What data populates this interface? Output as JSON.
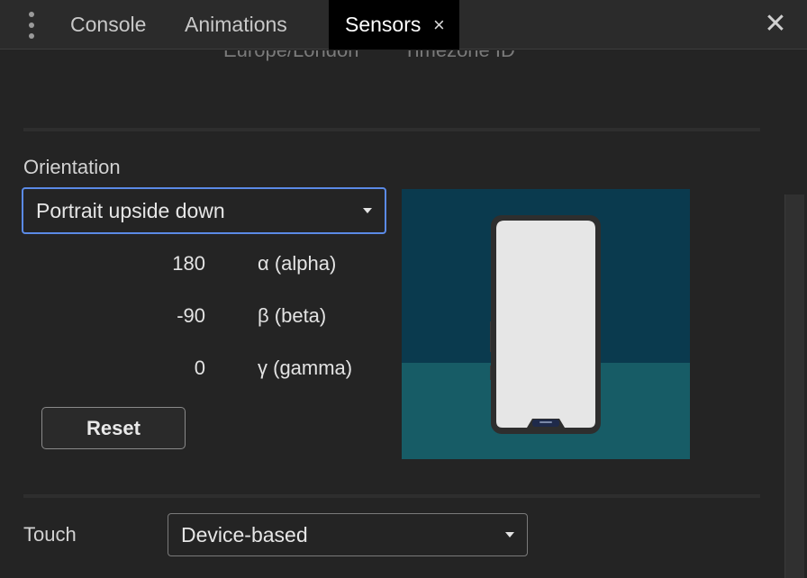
{
  "tabs": [
    {
      "label": "Console"
    },
    {
      "label": "Animations"
    },
    {
      "label": "Sensors",
      "active": true
    }
  ],
  "icons": {
    "menu": "more-vertical-icon",
    "tab_close": "×",
    "panel_close": "✕"
  },
  "timezone": {
    "value": "Europe/London",
    "label": "Timezone ID"
  },
  "orientation": {
    "title": "Orientation",
    "selected": "Portrait upside down",
    "alpha": {
      "value": "180",
      "label": "α (alpha)"
    },
    "beta": {
      "value": "-90",
      "label": "β (beta)"
    },
    "gamma": {
      "value": "0",
      "label": "γ (gamma)"
    },
    "reset_label": "Reset"
  },
  "touch": {
    "label": "Touch",
    "selected": "Device-based"
  },
  "colors": {
    "panel_bg": "#242424",
    "tabbar_bg": "#2b2b2b",
    "active_tab_bg": "#000000",
    "focus_ring": "#5b8ae6",
    "sky": "#0a3a4e",
    "floor": "#175c66"
  }
}
